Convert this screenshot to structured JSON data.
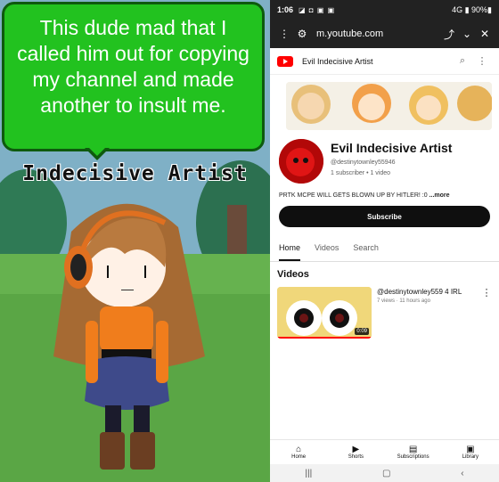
{
  "meme": {
    "bubble_text": "This dude mad that I called him out for copying my channel and made another to insult me.",
    "character_name": "Indecisive Artist"
  },
  "status_bar": {
    "time": "1:06",
    "left_icons": "◪ ◘ ▣ ▣",
    "right": "4G ▮ 90%▮"
  },
  "browser": {
    "url": "m.youtube.com",
    "icons": [
      "more-vert-icon",
      "site-settings-icon",
      "share-icon",
      "chevron-down-icon",
      "close-icon"
    ]
  },
  "yt_header": {
    "title": "Evil Indecisive Artist"
  },
  "channel": {
    "name": "Evil Indecisive Artist",
    "handle": "@destinytownley55946",
    "stats": "1 subscriber • 1 video",
    "description": "PRTK MCPE WILL GETS BLOWN UP BY HITLER! :0 ",
    "description_more": "...more",
    "subscribe_label": "Subscribe"
  },
  "tabs": [
    {
      "label": "Home",
      "active": true
    },
    {
      "label": "Videos",
      "active": false
    },
    {
      "label": "Search",
      "active": false
    }
  ],
  "videos_section_title": "Videos",
  "video": {
    "title": "@destinytownley559 4 IRL",
    "meta": "7 views · 11 hours ago",
    "duration": "0:09"
  },
  "bottom_nav": [
    {
      "label": "Home",
      "icon": "home-icon"
    },
    {
      "label": "Shorts",
      "icon": "shorts-icon"
    },
    {
      "label": "Subscriptions",
      "icon": "subscriptions-icon"
    },
    {
      "label": "Library",
      "icon": "library-icon"
    }
  ],
  "colors": {
    "bubble_green": "#22c21f",
    "youtube_red": "#ff0000",
    "subscribe_black": "#0f0f0f"
  }
}
